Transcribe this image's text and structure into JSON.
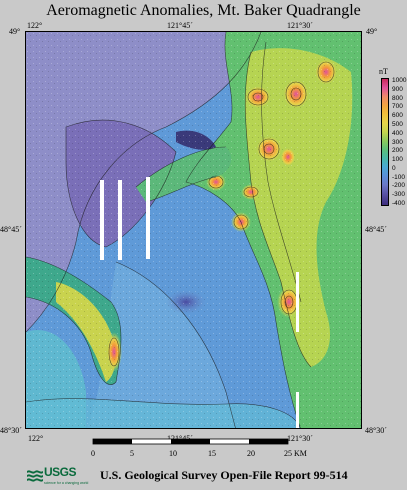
{
  "title": "Aeromagnetic Anomalies, Mt. Baker Quadrangle",
  "top_ticks": {
    "left": "122°",
    "mid": "121°45´",
    "right": "121°30´"
  },
  "bottom_ticks": {
    "left": "122°",
    "mid": "121°45´",
    "right": "121°30´"
  },
  "left_ticks": {
    "top": "49°",
    "mid": "48°45´",
    "bottom": "48°30´"
  },
  "right_ticks": {
    "top": "49°",
    "mid": "48°45´",
    "bottom": "48°30´"
  },
  "colorbar": {
    "unit": "nT",
    "labels": [
      "1000",
      "900",
      "800",
      "700",
      "600",
      "500",
      "400",
      "300",
      "200",
      "100",
      "0",
      "-100",
      "-200",
      "-300",
      "-400"
    ]
  },
  "scale": {
    "labels": [
      "0",
      "5",
      "10",
      "15",
      "20",
      "25 KM"
    ]
  },
  "footer": {
    "logo_text": "USGS",
    "logo_tagline": "science for a changing world",
    "report": "U.S. Geological Survey Open-File Report 99-514"
  }
}
